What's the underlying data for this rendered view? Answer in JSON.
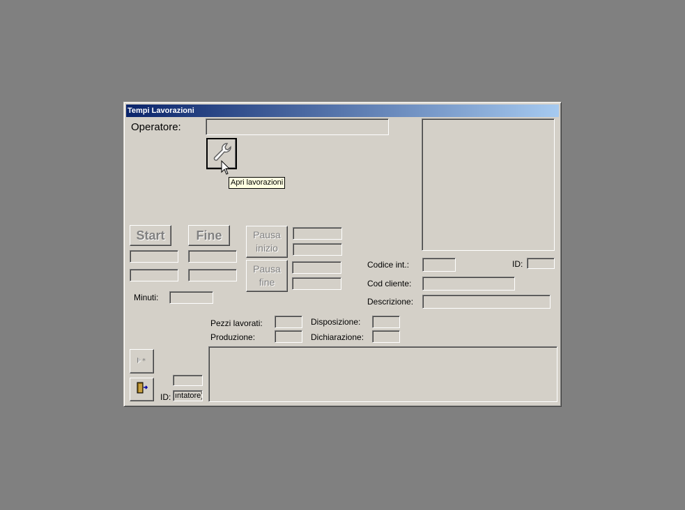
{
  "window": {
    "title": "Tempi Lavorazioni"
  },
  "operator": {
    "label": "Operatore:",
    "value": ""
  },
  "open_button": {
    "icon": "wrench-icon",
    "tooltip": "Apri lavorazioni"
  },
  "timing": {
    "start_label": "Start",
    "end_label": "Fine",
    "pause_start_label": [
      "Pausa",
      "inizio"
    ],
    "pause_end_label": [
      "Pausa",
      "fine"
    ],
    "minutes_label": "Minuti:"
  },
  "details": {
    "code_int_label": "Codice  int.:",
    "id_label": "ID:",
    "cod_cliente_label": "Cod cliente:",
    "descrizione_label": "Descrizione:",
    "pezzi_label": "Pezzi lavorati:",
    "produzione_label": "Produzione:",
    "disposizione_label": "Disposizione:",
    "dichiarazione_label": "Dichiarazione:"
  },
  "footer": {
    "new_record_icon": "new-record-icon",
    "exit_icon": "exit-door-icon",
    "id_label": "ID:",
    "id_value": "ıntatore)"
  }
}
